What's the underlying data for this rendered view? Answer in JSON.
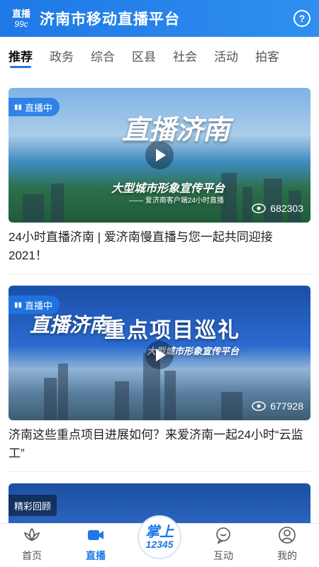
{
  "header": {
    "logo_line1": "直播",
    "logo_line2": "99c",
    "title": "济南市移动直播平台",
    "help_symbol": "?"
  },
  "tabs": [
    {
      "label": "推荐",
      "active": true
    },
    {
      "label": "政务"
    },
    {
      "label": "综合"
    },
    {
      "label": "区县"
    },
    {
      "label": "社会"
    },
    {
      "label": "活动"
    },
    {
      "label": "拍客"
    }
  ],
  "feed": [
    {
      "badge": "直播中",
      "overlay_main": "直播济南",
      "overlay_tagline": "大型城市形象宣传平台",
      "overlay_sub": "—— 爱济南客户端24小时直播",
      "views": "682303",
      "title": "24小时直播济南 | 爱济南慢直播与您一起共同迎接2021！"
    },
    {
      "badge": "直播中",
      "overlay_main": "直播济南",
      "overlay_headline": "重点项目巡礼",
      "overlay_tagline": "大型城市形象宣传平台",
      "views": "677928",
      "title": "济南这些重点项目进展如何？来爱济南一起24小时“云监工”"
    },
    {
      "badge": "精彩回顾"
    }
  ],
  "bottom_nav": {
    "items": [
      {
        "label": "首页",
        "icon": "lotus-icon"
      },
      {
        "label": "直播",
        "icon": "video-camera-icon",
        "active": true
      },
      {
        "label": "互动",
        "icon": "chat-bubble-icon"
      },
      {
        "label": "我的",
        "icon": "user-icon"
      }
    ],
    "center_logo_line1": "掌上",
    "center_logo_line2": "12345"
  },
  "colors": {
    "primary": "#1e78e6",
    "text": "#222222"
  }
}
